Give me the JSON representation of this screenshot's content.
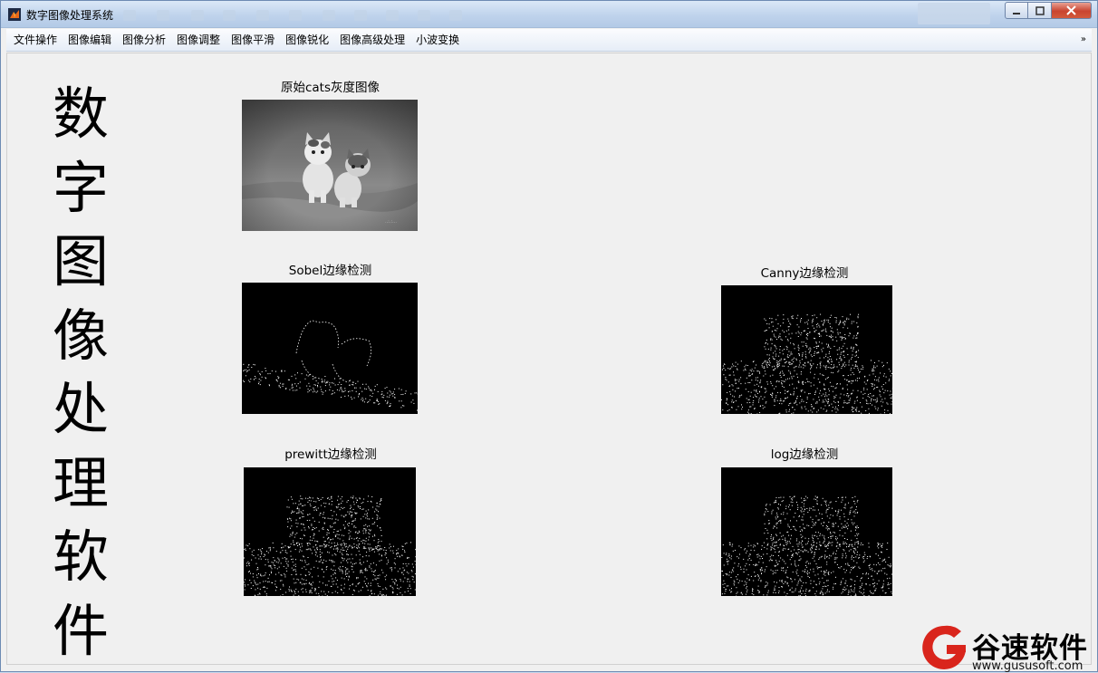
{
  "window": {
    "title": "数字图像处理系统"
  },
  "menu": [
    "文件操作",
    "图像编辑",
    "图像分析",
    "图像调整",
    "图像平滑",
    "图像锐化",
    "图像高级处理",
    "小波变换"
  ],
  "menu_overflow": "»",
  "app_title_chars": [
    "数",
    "字",
    "图",
    "像",
    "处",
    "理",
    "软",
    "件"
  ],
  "panels": {
    "original": {
      "title": "原始cats灰度图像"
    },
    "sobel": {
      "title": "Sobel边缘检测"
    },
    "canny": {
      "title": "Canny边缘检测"
    },
    "prewitt": {
      "title": "prewitt边缘检测"
    },
    "log": {
      "title": "log边缘检测"
    }
  },
  "watermark": {
    "name": "谷速软件",
    "url": "www.gususoft.com"
  },
  "colors": {
    "brand_red": "#d9251c",
    "client_bg": "#f0f0f0",
    "edge_bg": "#000000"
  }
}
